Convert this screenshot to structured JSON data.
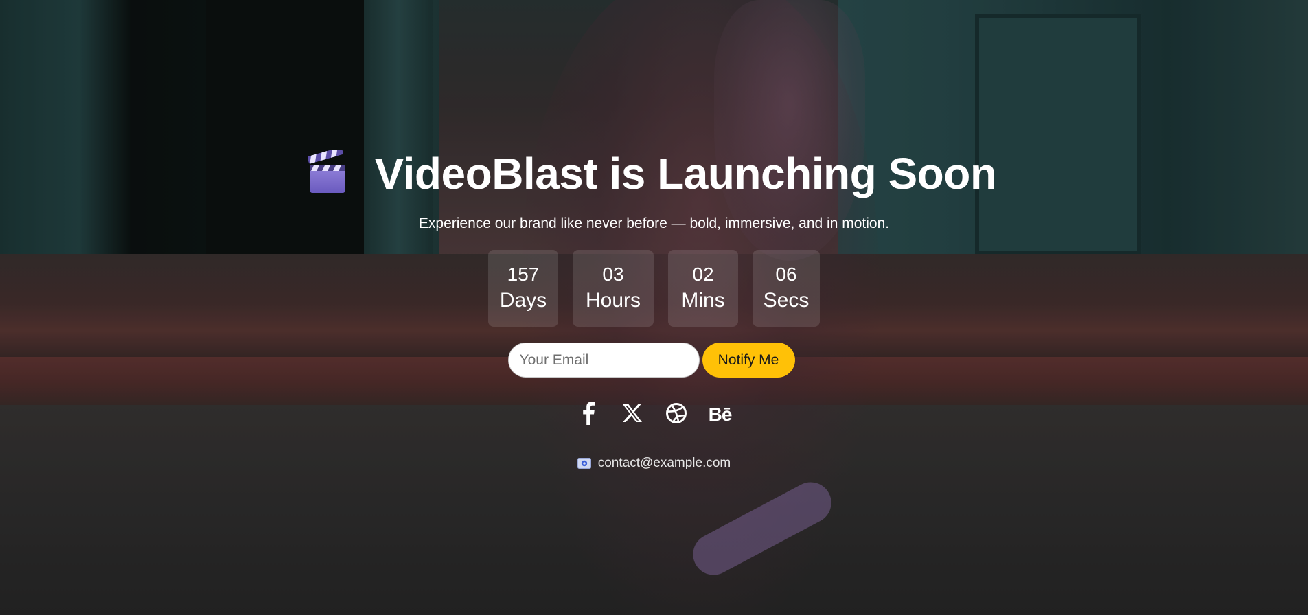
{
  "hero": {
    "title": "VideoBlast is Launching Soon",
    "title_icon": "clapper-board-icon",
    "subtitle": "Experience our brand like never before — bold, immersive, and in motion."
  },
  "countdown": {
    "days": {
      "value": "157",
      "label": "Days"
    },
    "hours": {
      "value": "03",
      "label": "Hours"
    },
    "mins": {
      "value": "02",
      "label": "Mins"
    },
    "secs": {
      "value": "06",
      "label": "Secs"
    }
  },
  "signup": {
    "email_placeholder": "Your Email",
    "email_value": "",
    "button_label": "Notify Me",
    "button_color": "#ffc107"
  },
  "social": {
    "items": [
      {
        "name": "facebook",
        "icon": "facebook-icon"
      },
      {
        "name": "x",
        "icon": "x-icon"
      },
      {
        "name": "dribbble",
        "icon": "dribbble-icon"
      },
      {
        "name": "behance",
        "icon": "behance-icon",
        "glyph": "Bē"
      }
    ]
  },
  "contact": {
    "icon": "envelope-icon",
    "email": "contact@example.com"
  }
}
